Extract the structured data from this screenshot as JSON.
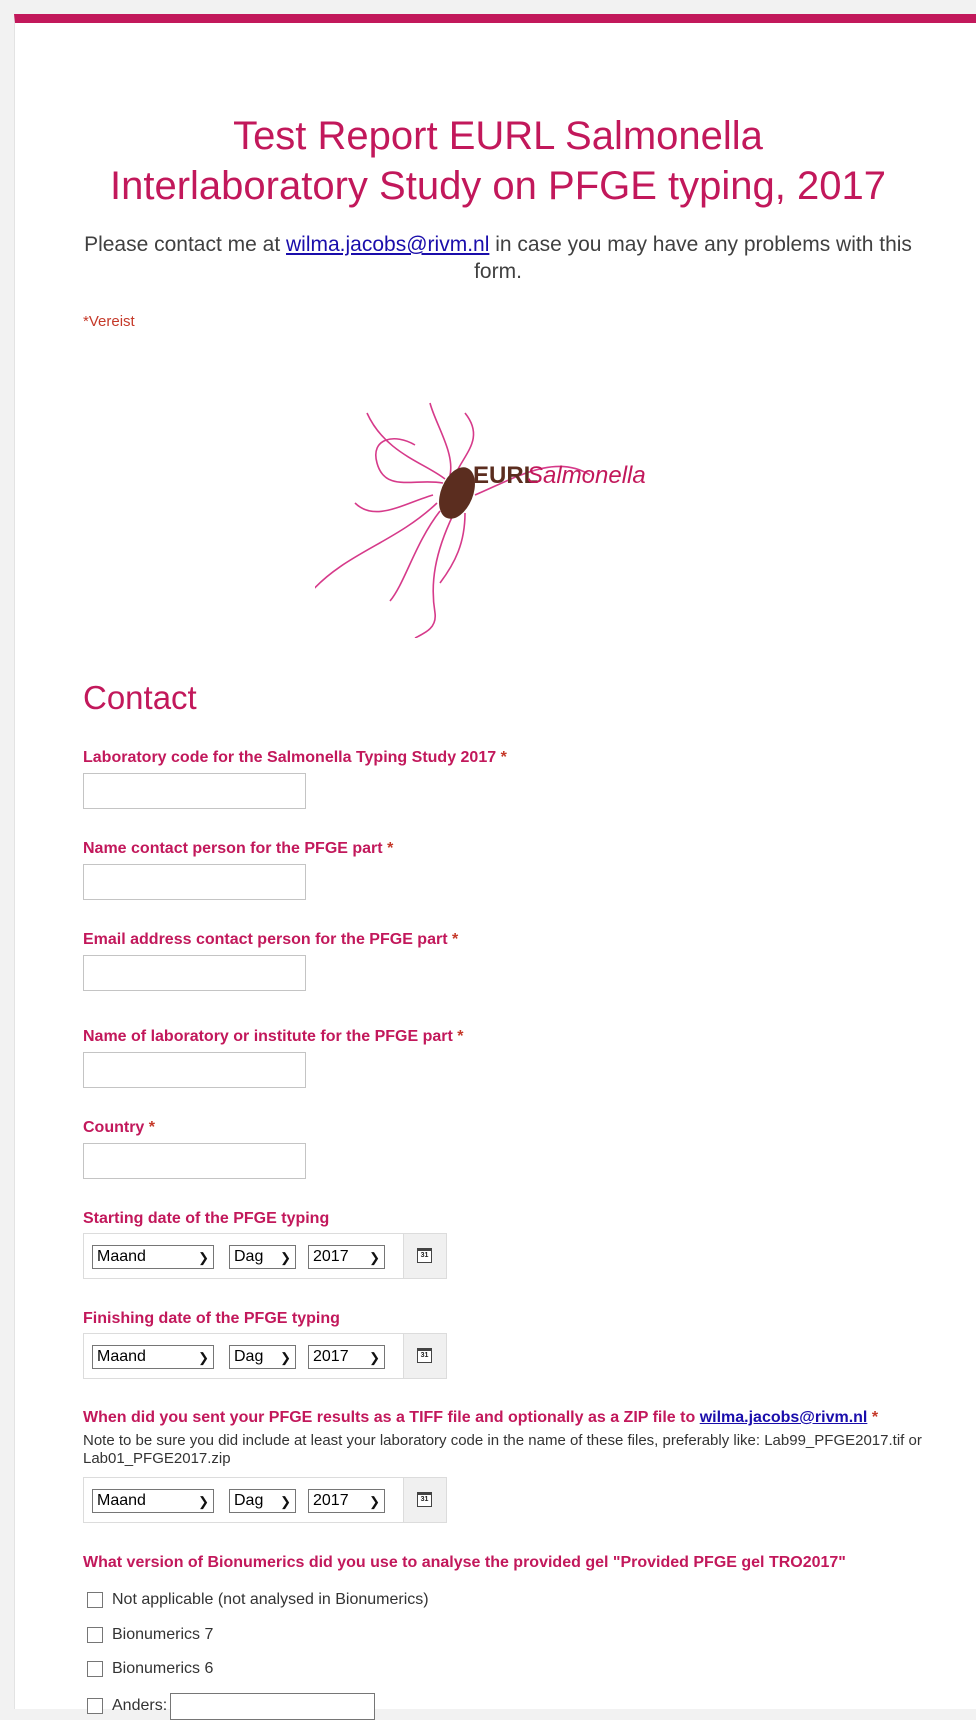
{
  "form": {
    "title_line1": "Test Report EURL Salmonella",
    "title_line2": "Interlaboratory Study on PFGE typing, 2017",
    "description_before": "Please contact me at ",
    "description_email": "wilma.jacobs@rivm.nl",
    "description_after": " in case you may have any problems with this form.",
    "required_note": "*Vereist",
    "logo_text_bold": "EURL",
    "logo_text_italic": "Salmonella",
    "section_title": "Contact"
  },
  "colors": {
    "accent": "#c2185b",
    "required": "#c53929",
    "logo_brown": "#5b2d1f"
  },
  "questions": [
    {
      "label": "Laboratory code for the Salmonella Typing Study 2017",
      "required": "*",
      "value": ""
    },
    {
      "label": "Name contact person for the PFGE part",
      "required": "*",
      "value": ""
    },
    {
      "label": "Email address contact person for the PFGE part",
      "required": "*",
      "value": ""
    },
    {
      "label": "Name of laboratory or institute for the PFGE part",
      "required": "*",
      "value": ""
    },
    {
      "label": "Country",
      "required": "*",
      "value": ""
    }
  ],
  "dates": [
    {
      "label": "Starting date of the PFGE typing",
      "month": "Maand",
      "day": "Dag",
      "year": "2017",
      "icon": "calendar-icon",
      "icon_text": "31"
    },
    {
      "label": "Finishing date of the PFGE typing",
      "month": "Maand",
      "day": "Dag",
      "year": "2017",
      "icon": "calendar-icon",
      "icon_text": "31"
    },
    {
      "label_before": "When did you sent your PFGE results as a TIFF file and optionally as a ZIP file to ",
      "label_email": "wilma.jacobs@rivm.nl",
      "required": "*",
      "help": "Note to be sure you did include at least your laboratory code in the name of these files, preferably like: Lab99_PFGE2017.tif or Lab01_PFGE2017.zip",
      "month": "Maand",
      "day": "Dag",
      "year": "2017",
      "icon": "calendar-icon",
      "icon_text": "31"
    }
  ],
  "bionumerics": {
    "label": "What version of Bionumerics did you use to analyse the provided gel \"Provided PFGE gel TRO2017\"",
    "options": [
      "Not applicable (not analysed in Bionumerics)",
      "Bionumerics 7",
      "Bionumerics 6"
    ],
    "other_label": "Anders:",
    "other_value": ""
  }
}
